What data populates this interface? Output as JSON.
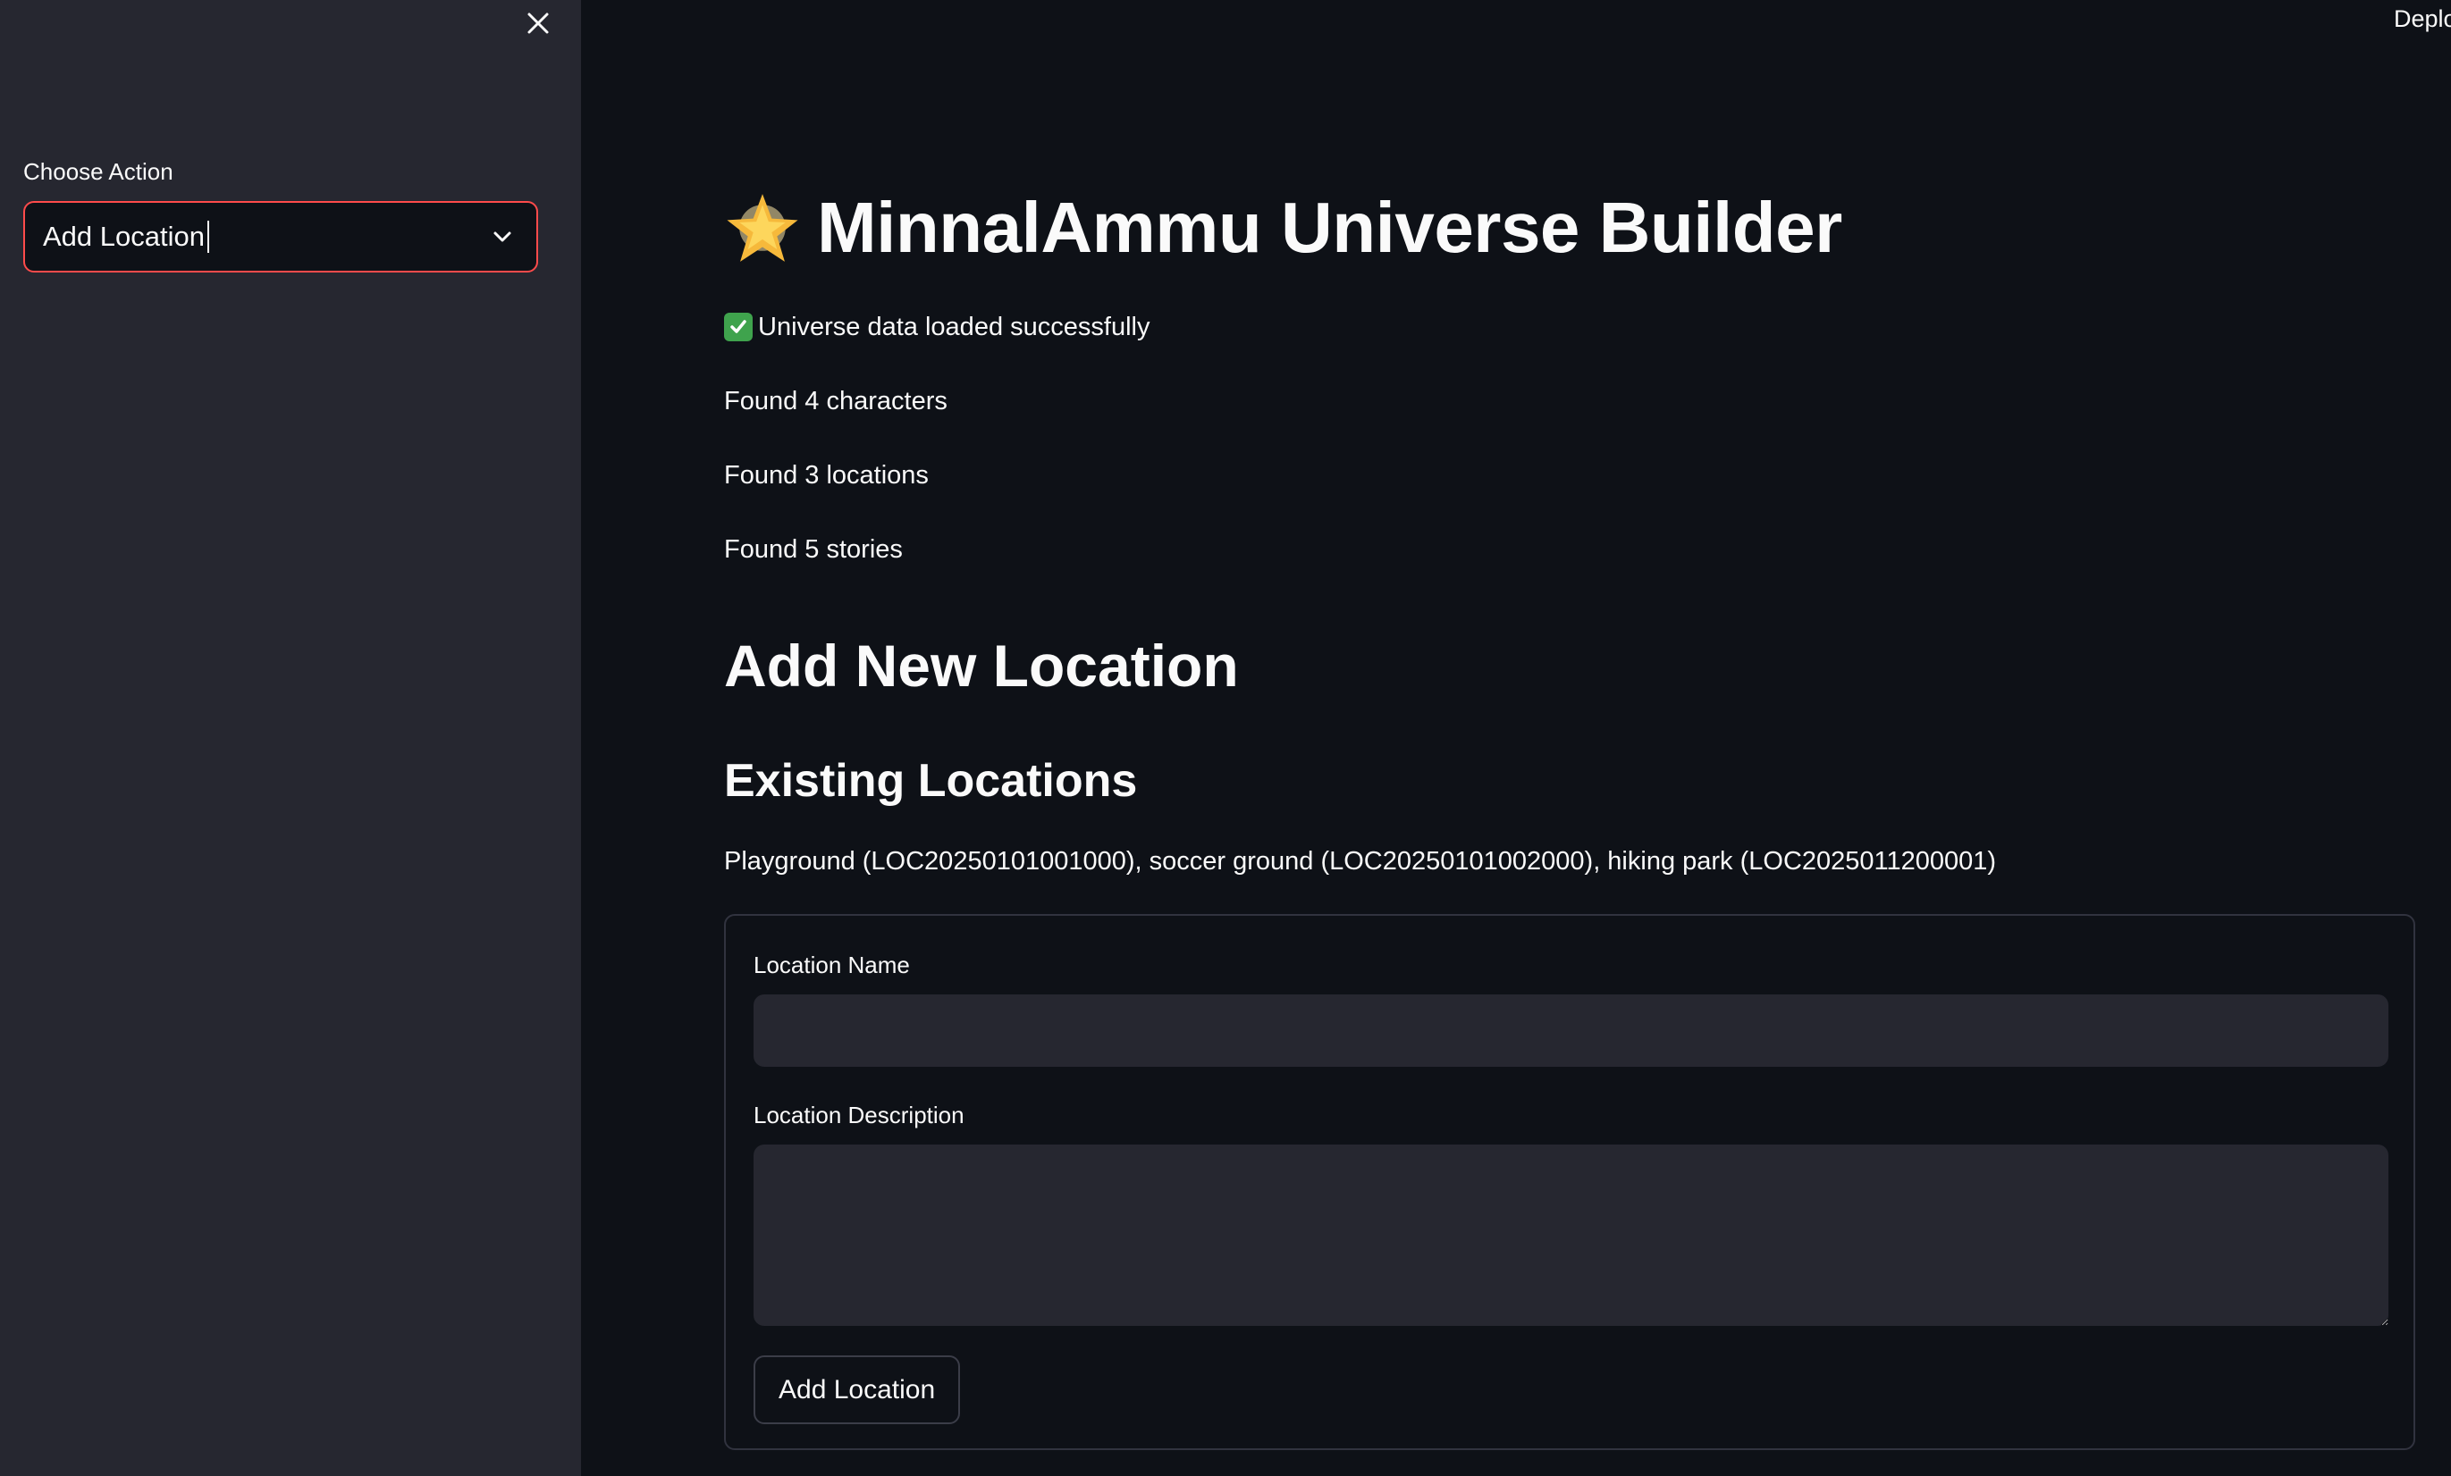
{
  "sidebar": {
    "close_icon": "close-icon",
    "choose_action_label": "Choose Action",
    "action_select": {
      "value": "Add Location",
      "icon": "chevron-down-icon"
    }
  },
  "header": {
    "deploy_label": "Deplo"
  },
  "main": {
    "title_icon": "glowing-star-icon",
    "title": "MinnalAmmu Universe Builder",
    "status": {
      "icon": "check-mark-icon",
      "text": "Universe data loaded successfully"
    },
    "stats": [
      "Found 4 characters",
      "Found 3 locations",
      "Found 5 stories"
    ],
    "section_title": "Add New Location",
    "existing_title": "Existing Locations",
    "existing_list": "Playground (LOC20250101001000), soccer ground (LOC20250101002000), hiking park (LOC2025011200001)",
    "form": {
      "name_label": "Location Name",
      "name_value": "",
      "description_label": "Location Description",
      "description_value": "",
      "submit_label": "Add Location"
    }
  },
  "colors": {
    "app_background": "#0e1117",
    "sidebar_background": "#262730",
    "input_background": "#262730",
    "focus_border": "#ff4b4b",
    "text": "#fafafa"
  }
}
